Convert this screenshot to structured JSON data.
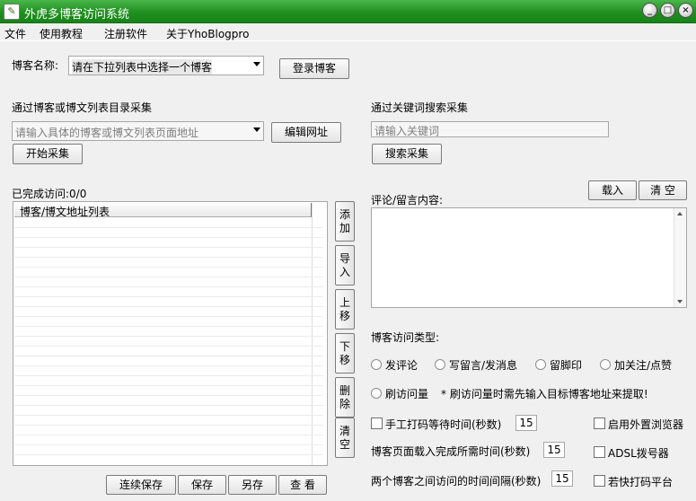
{
  "window": {
    "title": "外虎多博客访问系统",
    "icon": "app-logo-icon",
    "min": "_",
    "max": "□",
    "close": "×"
  },
  "menu": [
    "文件",
    "使用教程",
    "注册软件",
    "关于YhoBlogpro"
  ],
  "blog": {
    "label": "博客名称:",
    "selected": "请在下拉列表中选择一个博客",
    "login_label": "登录博客"
  },
  "collect": {
    "section_label": "通过博客或博文列表目录采集",
    "placeholder": "请输入具体的博客或博文列表页面地址",
    "edit_label": "编辑网址",
    "start_label": "开始采集"
  },
  "keyword": {
    "section_label": "通过关键词搜索采集",
    "placeholder": "请输入关键词",
    "search_label": "搜索采集"
  },
  "progress": {
    "label": "已完成访问:0/0"
  },
  "list": {
    "header": "博客/博文地址列表"
  },
  "side_buttons": [
    "添加",
    "导入",
    "上移",
    "下移",
    "删除",
    "清空"
  ],
  "bottom_buttons": [
    "连续保存",
    "保存",
    "另存",
    "查 看"
  ],
  "comment": {
    "label": "评论/留言内容:",
    "load_label": "载入",
    "clear_label": "清 空"
  },
  "visit": {
    "type_label": "博客访问类型:",
    "options": [
      "发评论",
      "写留言/发消息",
      "留脚印",
      "加关注/点赞",
      "刷访问量"
    ],
    "note": "* 刷访问量时需先输入目标博客地址来提取!"
  },
  "settings": {
    "manual_label": "手工打码等待时间(秒数)",
    "manual_value": "15",
    "load_label": "博客页面载入完成所需时间(秒数)",
    "load_value": "15",
    "interval_label": "两个博客之间访问的时间间隔(秒数)",
    "interval_value": "15",
    "browser_label": "启用外置浏览器",
    "adsl_label": "ADSL拨号器",
    "captcha_label": "若快打码平台"
  },
  "colors": {
    "titlebar": "#1f8f1f",
    "background": "#f0f0f0"
  }
}
